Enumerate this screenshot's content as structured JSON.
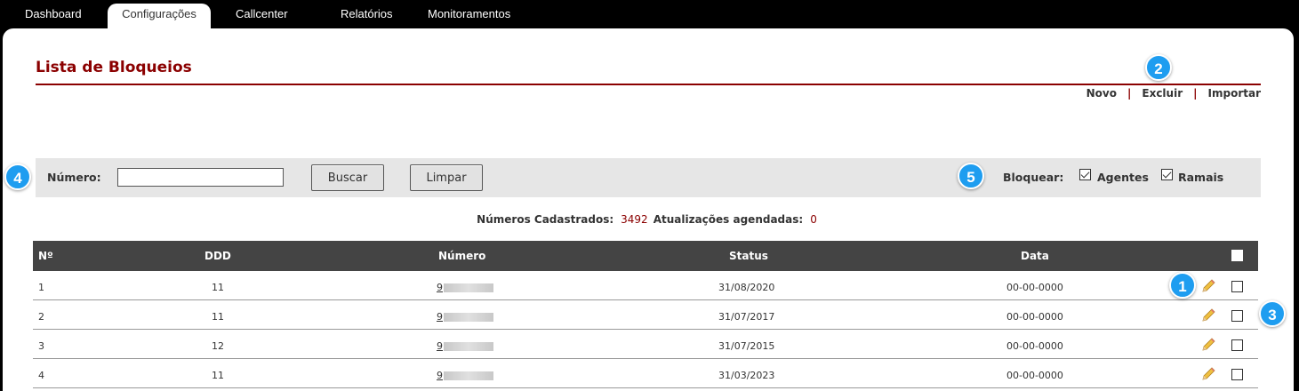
{
  "nav": {
    "tabs": [
      {
        "label": "Dashboard"
      },
      {
        "label": "Configurações"
      },
      {
        "label": "Callcenter"
      },
      {
        "label": "Relatórios"
      },
      {
        "label": "Monitoramentos"
      }
    ],
    "active_tab": "Configurações"
  },
  "page": {
    "title": "Lista de Bloqueios",
    "actions": {
      "novo": "Novo",
      "excluir": "Excluir",
      "importar": "Importar",
      "separator": "|"
    }
  },
  "badges": {
    "b1": "1",
    "b2": "2",
    "b3": "3",
    "b4": "4",
    "b5": "5"
  },
  "filter": {
    "numero_label": "Número:",
    "numero_value": "",
    "buscar_label": "Buscar",
    "limpar_label": "Limpar",
    "bloquear_label": "Bloquear:",
    "agentes_label": "Agentes",
    "agentes_checked": true,
    "ramais_label": "Ramais",
    "ramais_checked": true
  },
  "summary": {
    "cadastrados_label": "Números Cadastrados:",
    "cadastrados_value": "3492",
    "agendadas_label": "Atualizações agendadas:",
    "agendadas_value": "0"
  },
  "table": {
    "headers": {
      "n": "Nº",
      "ddd": "DDD",
      "numero": "Número",
      "status": "Status",
      "data": "Data"
    },
    "rows": [
      {
        "n": "1",
        "ddd": "11",
        "numero_visible": "9",
        "status": "31/08/2020",
        "data": "00-00-0000"
      },
      {
        "n": "2",
        "ddd": "11",
        "numero_visible": "9",
        "status": "31/07/2017",
        "data": "00-00-0000"
      },
      {
        "n": "3",
        "ddd": "12",
        "numero_visible": "9",
        "status": "31/07/2015",
        "data": "00-00-0000"
      },
      {
        "n": "4",
        "ddd": "11",
        "numero_visible": "9",
        "status": "31/03/2023",
        "data": "00-00-0000"
      }
    ]
  },
  "colors": {
    "accent": "#8b0000",
    "header_bg": "#444444",
    "badge": "#1e9df0",
    "filter_bg": "#e6e6e6"
  },
  "icons": {
    "edit": "pencil-icon"
  }
}
